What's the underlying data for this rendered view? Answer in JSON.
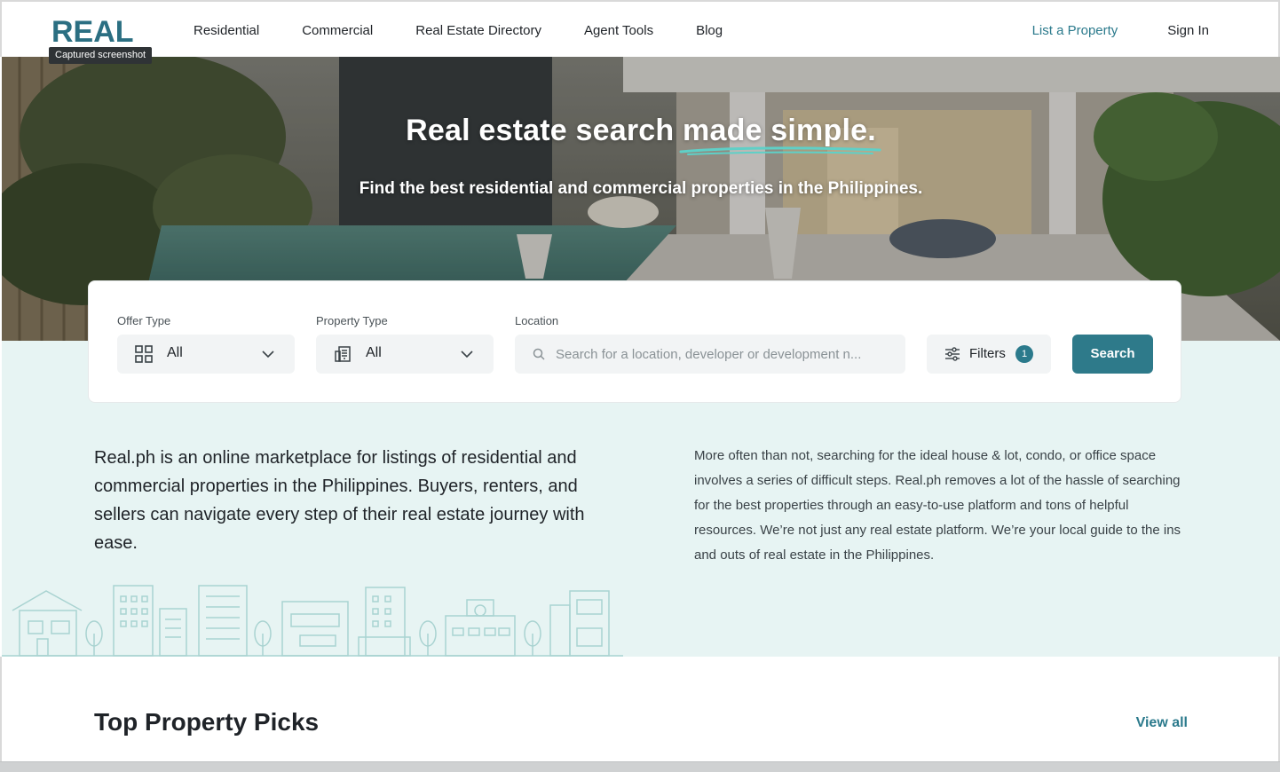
{
  "header": {
    "logo_text": "REAL",
    "tooltip": "Captured screenshot",
    "nav": [
      "Residential",
      "Commercial",
      "Real Estate Directory",
      "Agent Tools",
      "Blog"
    ],
    "list_property": "List a Property",
    "sign_in": "Sign In"
  },
  "hero": {
    "title_start": "Real estate search ",
    "title_highlight": "made simple.",
    "subtitle": "Find the best residential and commercial properties in the Philippines."
  },
  "search": {
    "offer_type_label": "Offer Type",
    "offer_type_value": "All",
    "property_type_label": "Property Type",
    "property_type_value": "All",
    "location_label": "Location",
    "location_placeholder": "Search for a location, developer or development n...",
    "filters_label": "Filters",
    "filters_count": "1",
    "search_button": "Search"
  },
  "about": {
    "lead": "Real.ph is an online marketplace for listings of residential and commercial properties in the Philippines. Buyers, renters, and sellers can navigate every step of their real estate journey with ease.",
    "body": "More often than not, searching for the ideal house & lot, condo, or office space involves a series of difficult steps. Real.ph removes a lot of the hassle of searching for the best properties through an easy-to-use platform and tons of helpful resources. We’re not just any real estate platform. We’re your local guide to the ins and outs of real estate in the Philippines."
  },
  "picks": {
    "title": "Top Property Picks",
    "view_all": "View all"
  },
  "colors": {
    "brand_teal": "#2e7a8a",
    "link_teal": "#2b7a8c",
    "band_bg": "#e7f4f3",
    "highlight_stroke": "#5fd0c7"
  },
  "icons": {
    "offer_type": "grid-icon",
    "property_type": "building-icon",
    "location": "search-icon",
    "filters": "sliders-icon",
    "dropdown": "chevron-down-icon"
  }
}
